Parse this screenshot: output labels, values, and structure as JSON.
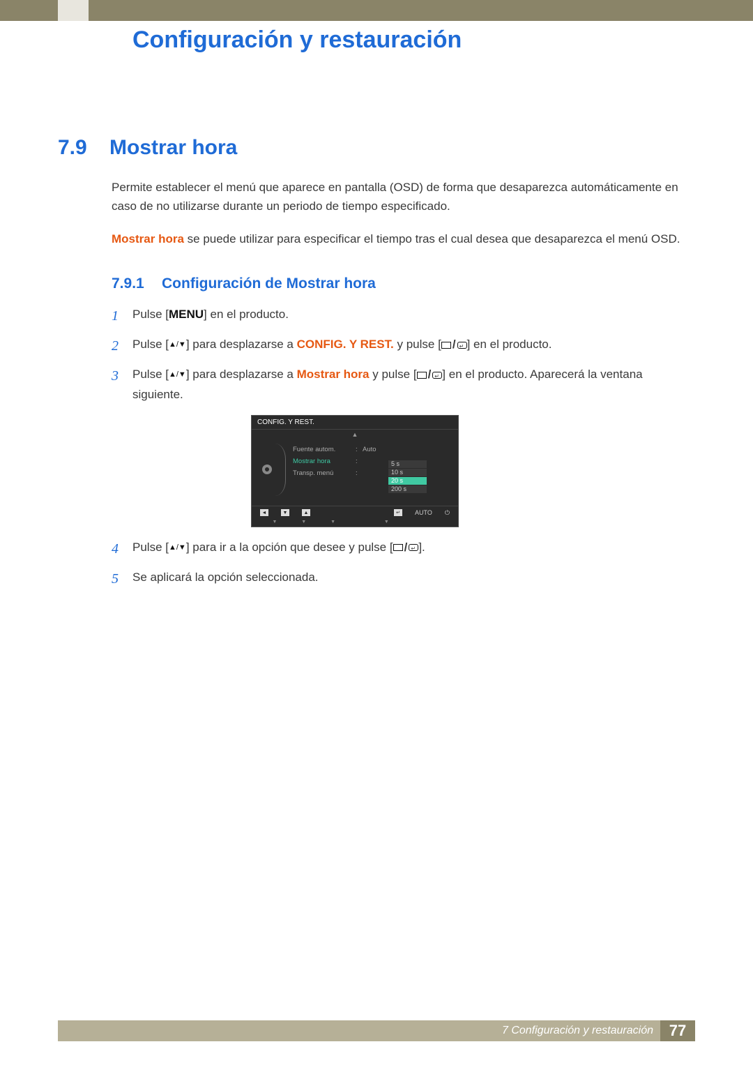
{
  "chapter_title": "Configuración y restauración",
  "section": {
    "num": "7.9",
    "title": "Mostrar hora"
  },
  "paragraphs": {
    "p1": "Permite establecer el menú que aparece en pantalla (OSD) de forma que desaparezca automáticamente en caso de no utilizarse durante un periodo de tiempo especificado.",
    "p2_lead": "Mostrar hora",
    "p2_rest": " se puede utilizar para especificar el tiempo tras el cual desea que desaparezca el menú OSD."
  },
  "subsection": {
    "num": "7.9.1",
    "title": "Configuración de Mostrar hora"
  },
  "steps": [
    {
      "n": "1",
      "pre": "Pulse [",
      "menu": "MENU",
      "post": "] en el producto."
    },
    {
      "n": "2",
      "pre": "Pulse [",
      "mid1": "] para desplazarse a ",
      "bold": "CONFIG. Y REST.",
      "mid2": " y pulse [",
      "post": "] en el producto."
    },
    {
      "n": "3",
      "pre": "Pulse [",
      "mid1": "] para desplazarse a ",
      "bold": "Mostrar hora",
      "mid2": " y pulse [",
      "post": "] en el producto. Aparecerá la ventana siguiente."
    },
    {
      "n": "4",
      "pre": "Pulse [",
      "mid1": "] para ir a la opción que desee y pulse [",
      "post": "]."
    },
    {
      "n": "5",
      "text": "Se aplicará la opción seleccionada."
    }
  ],
  "osd": {
    "title": "CONFIG. Y REST.",
    "rows": [
      {
        "label": "Fuente autom.",
        "value": "Auto",
        "active": false
      },
      {
        "label": "Mostrar hora",
        "value": "",
        "active": true
      },
      {
        "label": "Transp. menú",
        "value": "",
        "active": false
      }
    ],
    "options": [
      "5 s",
      "10 s",
      "20 s",
      "200 s"
    ],
    "selected_option_index": 2,
    "bottom": {
      "auto": "AUTO"
    }
  },
  "footer": {
    "text": "7 Configuración y restauración",
    "page": "77"
  }
}
